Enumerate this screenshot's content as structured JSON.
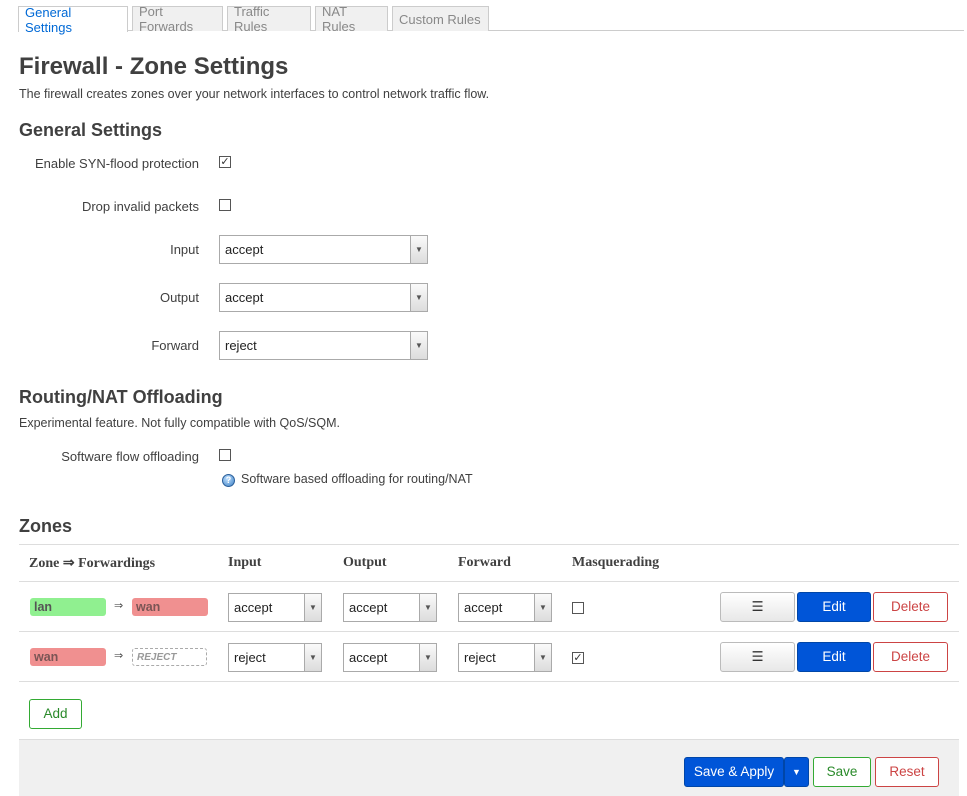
{
  "tabs": [
    {
      "label": "General Settings",
      "active": true
    },
    {
      "label": "Port Forwards",
      "active": false
    },
    {
      "label": "Traffic Rules",
      "active": false
    },
    {
      "label": "NAT Rules",
      "active": false
    },
    {
      "label": "Custom Rules",
      "active": false
    }
  ],
  "page": {
    "title": "Firewall - Zone Settings",
    "description": "The firewall creates zones over your network interfaces to control network traffic flow."
  },
  "general": {
    "heading": "General Settings",
    "syn_flood_label": "Enable SYN-flood protection",
    "syn_flood_checked": true,
    "drop_invalid_label": "Drop invalid packets",
    "drop_invalid_checked": false,
    "input_label": "Input",
    "input_value": "accept",
    "output_label": "Output",
    "output_value": "accept",
    "forward_label": "Forward",
    "forward_value": "reject"
  },
  "offloading": {
    "heading": "Routing/NAT Offloading",
    "description": "Experimental feature. Not fully compatible with QoS/SQM.",
    "software_label": "Software flow offloading",
    "software_checked": false,
    "help_text": "Software based offloading for routing/NAT"
  },
  "zones": {
    "heading": "Zones",
    "columns": [
      "Zone ⇒ Forwardings",
      "Input",
      "Output",
      "Forward",
      "Masquerading"
    ],
    "rows": [
      {
        "zone": "lan",
        "arrow": "⇒",
        "dest": "wan",
        "input": "accept",
        "output": "accept",
        "forward": "accept",
        "masquerading": false
      },
      {
        "zone": "wan",
        "arrow": "⇒",
        "dest": "REJECT",
        "input": "reject",
        "output": "accept",
        "forward": "reject",
        "masquerading": true
      }
    ],
    "menu_label": "☰",
    "edit_label": "Edit",
    "delete_label": "Delete",
    "add_label": "Add"
  },
  "footer": {
    "save_apply_label": "Save & Apply",
    "save_label": "Save",
    "reset_label": "Reset"
  },
  "colors": {
    "accent": "#0055d8",
    "lan_zone": "#90f090",
    "wan_zone": "#f09090",
    "positive": "#2a8a2a",
    "negative": "#cc4444"
  }
}
